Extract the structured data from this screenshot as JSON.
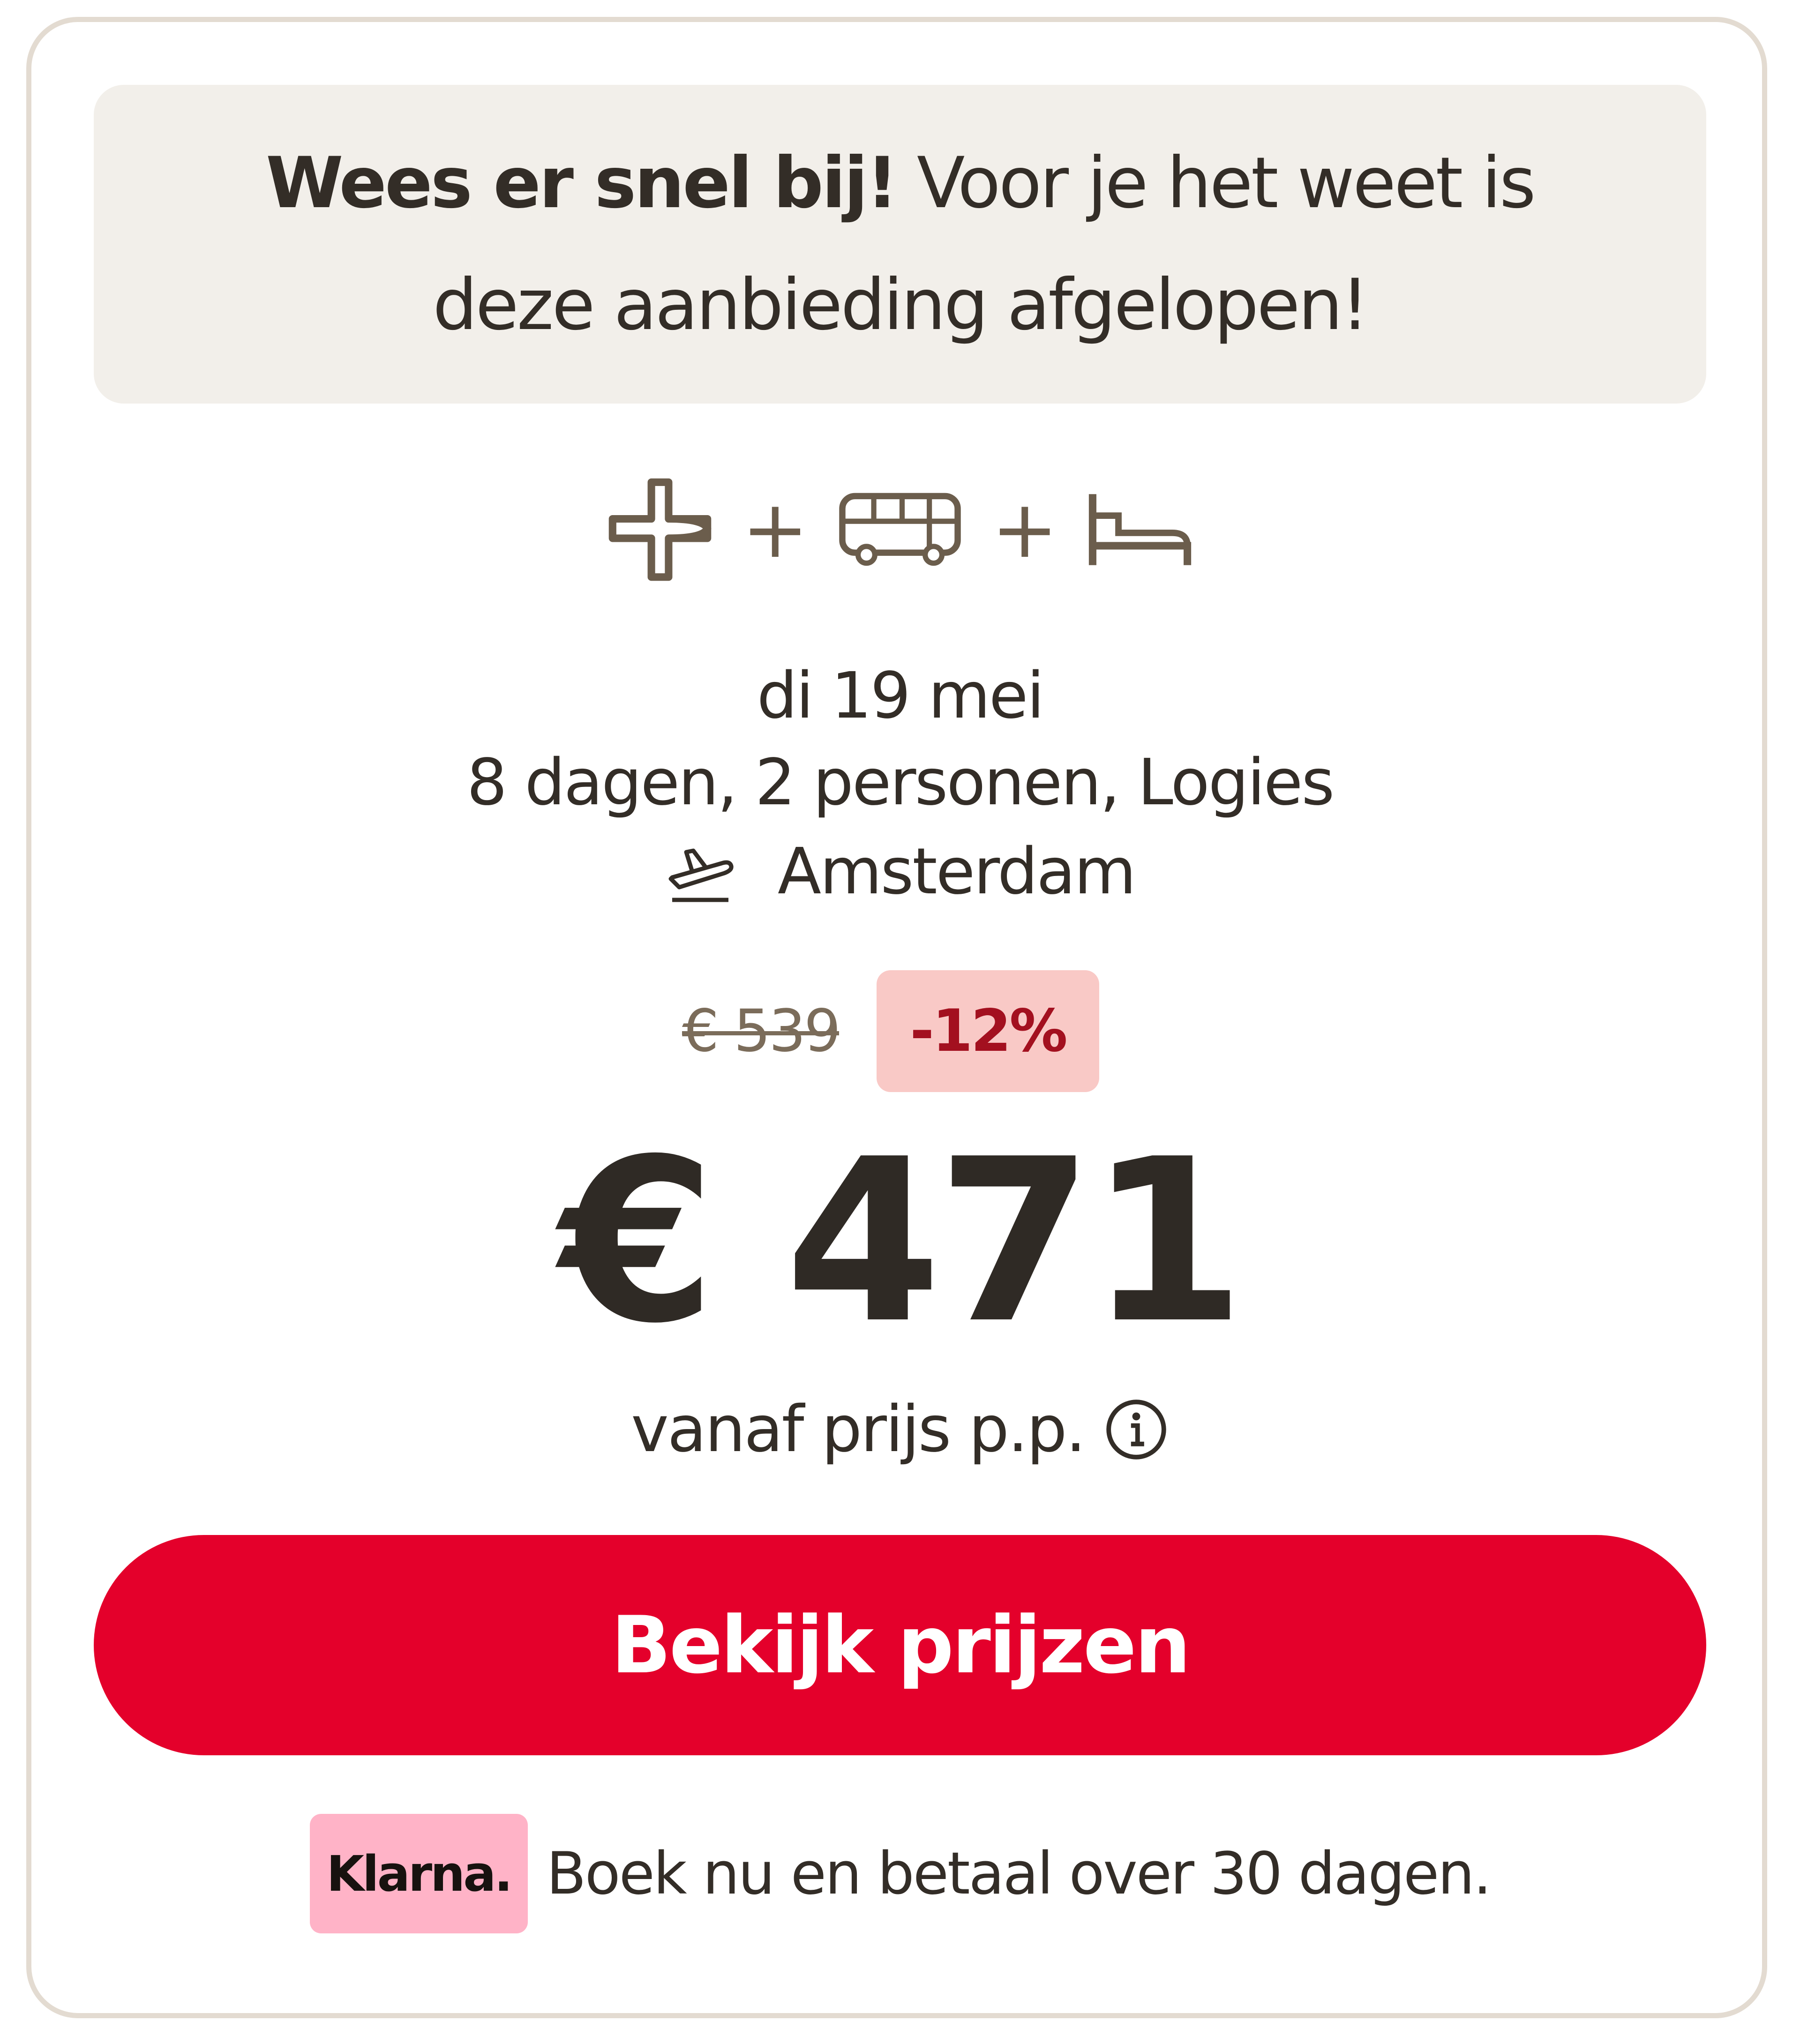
{
  "banner": {
    "strong": "Wees er snel bij!",
    "rest": " Voor je het weet is deze aanbieding afgelopen!"
  },
  "package": {
    "components": [
      "plane-icon",
      "bus-icon",
      "bed-icon"
    ],
    "separator": "+"
  },
  "trip": {
    "date": "di 19 mei",
    "details": "8 dagen, 2 personen, Logies",
    "departure": "Amsterdam"
  },
  "pricing": {
    "old_price": "€ 539",
    "discount": "-12%",
    "price": "€ 471",
    "note": "vanaf prijs p.p."
  },
  "cta": {
    "label": "Bekijk prijzen"
  },
  "klarna": {
    "logo": "Klarna.",
    "text": "Boek nu en betaal over 30 dagen."
  },
  "colors": {
    "accent_red": "#e4002b",
    "discount_bg": "#f9c9c6",
    "discount_text": "#a3101f",
    "banner_bg": "#f2efea",
    "klarna_pink": "#ffb3c7",
    "icon_brown": "#6b5d4c"
  }
}
